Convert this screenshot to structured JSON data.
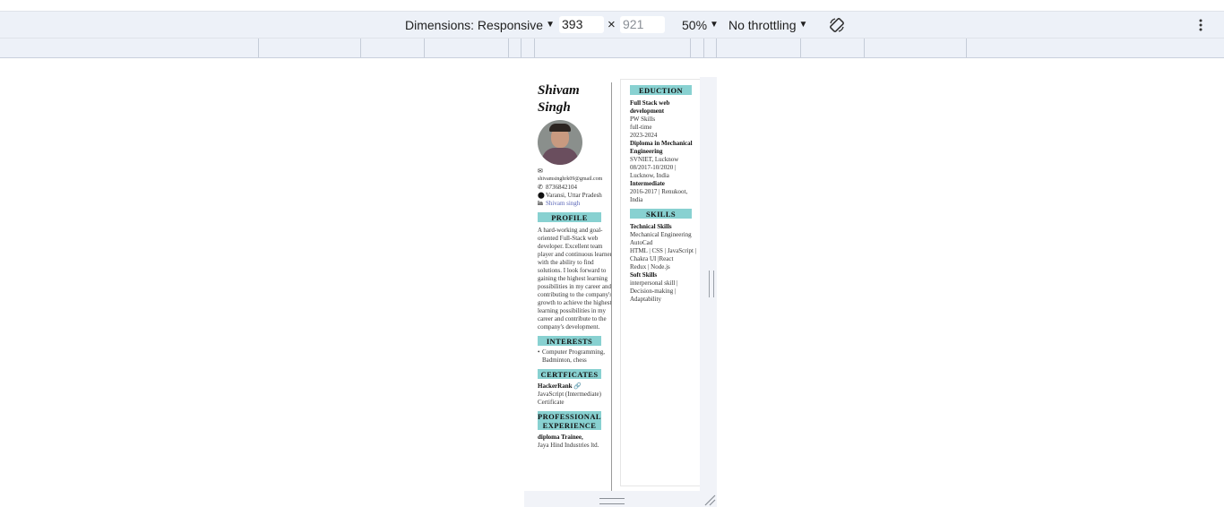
{
  "devtools": {
    "dimensions_label": "Dimensions: Responsive",
    "width_value": "393",
    "times_symbol": "×",
    "height_value": "921",
    "zoom_label": "50%",
    "throttling_label": "No throttling",
    "rotate_icon": "rotate-icon",
    "more_icon": "more-vert-icon"
  },
  "resume": {
    "name": "Shivam Singh",
    "contact": {
      "email": "shivamsinghrk09@gmail.com",
      "phone": "8736842104",
      "location": "Varansi, Uttar Pradesh",
      "linkedin": "Shivam singh"
    },
    "profile": {
      "heading": "PROFILE",
      "text": "A hard-working and goal-oriented Full-Stack web developer. Excellent team player and continuous learner with the ability to find solutions. I look forward to gaining the highest learning possibilities in my career and contributing to the company's growth to achieve the highest learning possibilities in my career and contribute to the company's development."
    },
    "interests": {
      "heading": "INTERESTS",
      "items": [
        "Computer Programming, Badminton, chess"
      ]
    },
    "certificates": {
      "heading": "CERTFICATES",
      "items": [
        {
          "title": "HackerRank",
          "text": "JavaScript (Intermediate) Certificate"
        }
      ]
    },
    "experience": {
      "heading": "PROFESSIONAL EXPERIENCE",
      "items": [
        {
          "title": "diploma Trainee,",
          "company": "Jaya Hind Industries ltd."
        }
      ]
    },
    "education": {
      "heading": "EDUCTION",
      "items": [
        {
          "title": "Full Stack web development",
          "lines": [
            "PW Skills",
            "full-time",
            "2023-2024"
          ]
        },
        {
          "title": "Diploma in Mechanical Engineering",
          "lines": [
            "SVNIET, Lucknow",
            "08/2017-10/2020 | Lucknow, India"
          ]
        },
        {
          "title": "Intermediate",
          "lines": [
            "2016-2017 | Renukoot, India"
          ]
        }
      ]
    },
    "skills": {
      "heading": "SKILLS",
      "technical_title": "Technical Skills",
      "technical_lines": [
        "Mechanical Engineering",
        "AutoCad",
        "HTML | CSS | JavaScript | Chakra UI |React",
        "Redux | Node.js"
      ],
      "soft_title": "Soft Skills",
      "soft_lines": [
        "interpersonal skill | Decision-making | Adaptability"
      ]
    }
  },
  "colors": {
    "toolbar_bg": "#edf1f8",
    "section_heading_bg": "#88d1d1",
    "link": "#5a66b8"
  }
}
